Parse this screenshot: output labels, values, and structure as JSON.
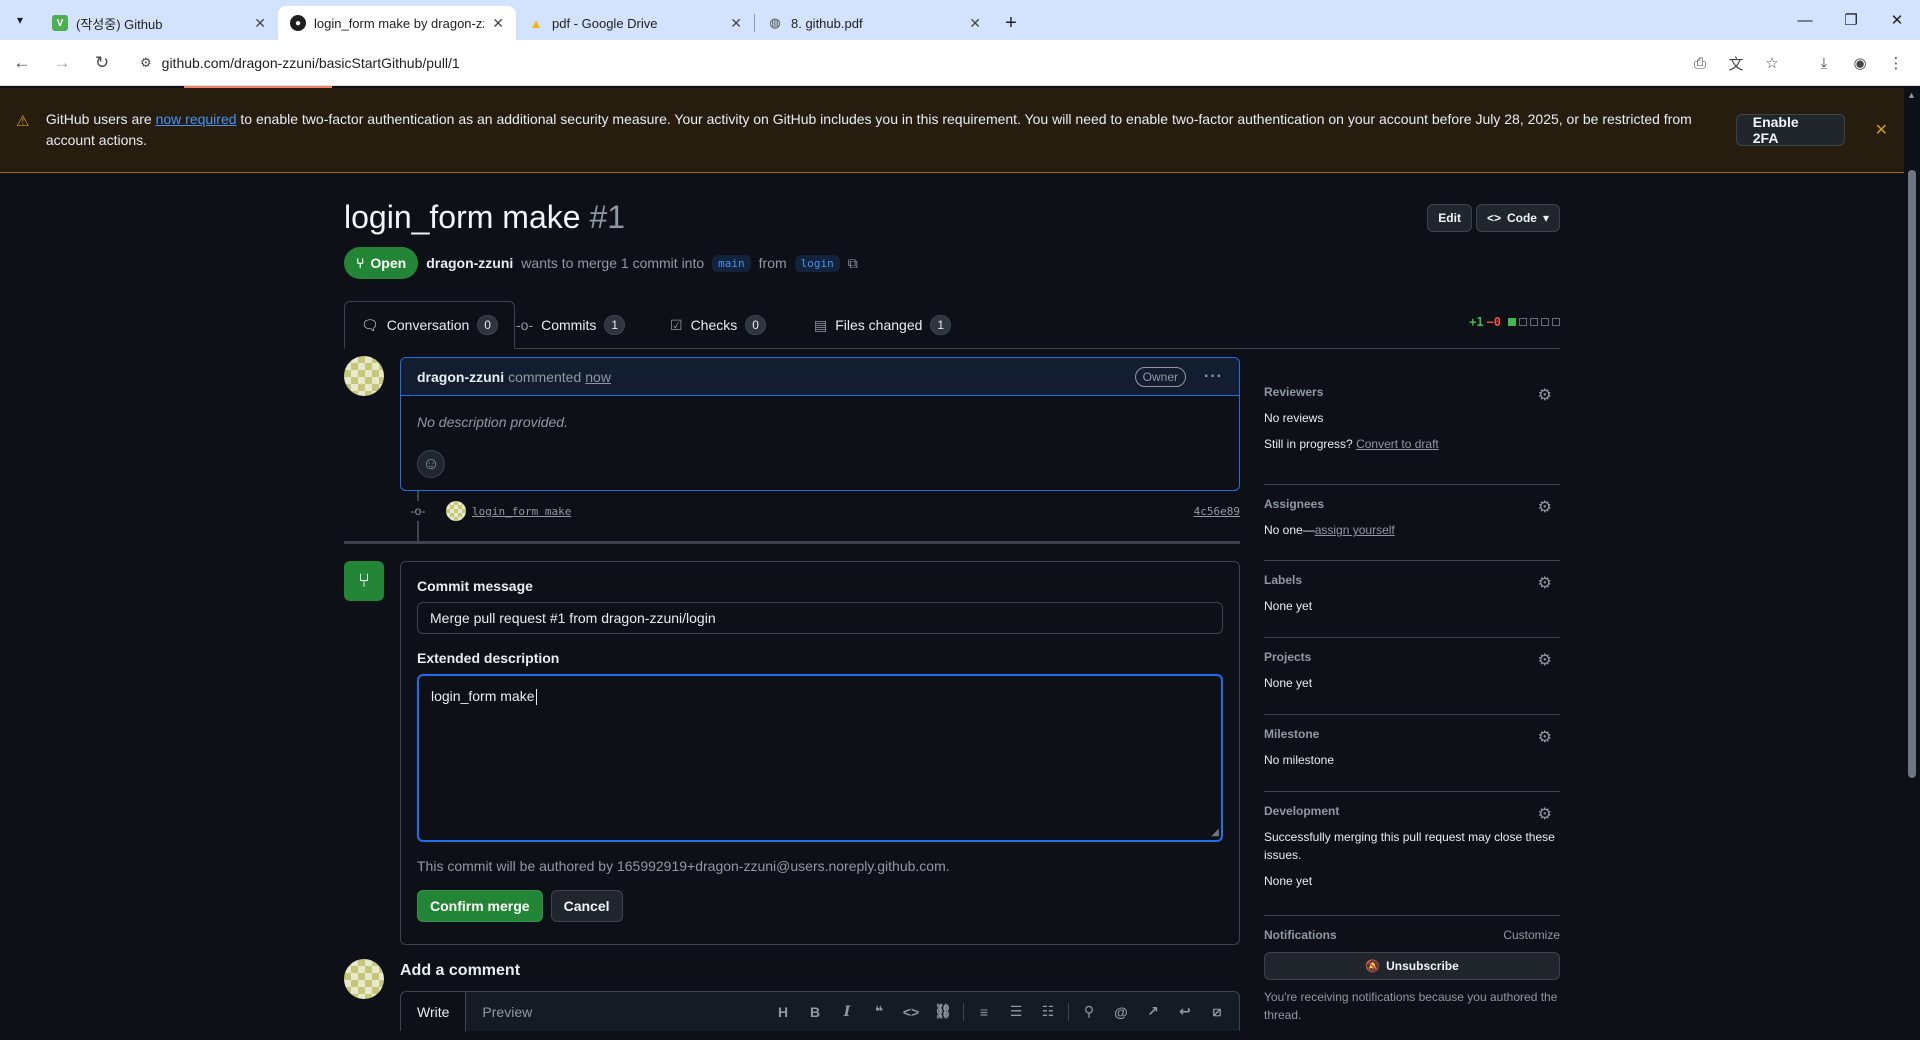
{
  "browser": {
    "tabs": [
      {
        "title": "(작성중) Github",
        "favicon": "V",
        "favicon_color": "#4caf50",
        "active": false
      },
      {
        "title": "login_form make by dragon-zzuni",
        "favicon": "github-icon",
        "active": true
      },
      {
        "title": "pdf - Google Drive",
        "favicon": "drive-icon",
        "active": false
      },
      {
        "title": "8. github.pdf",
        "favicon": "globe-icon",
        "active": false
      }
    ],
    "url": "github.com/dragon-zzuni/basicStartGithub/pull/1"
  },
  "banner": {
    "text_before": "GitHub users are ",
    "link": "now required",
    "text_after": " to enable two-factor authentication as an additional security measure. Your activity on GitHub includes you in this requirement. You will need to enable two-factor authentication on your account before July 28, 2025, or be restricted from account actions.",
    "button": "Enable 2FA"
  },
  "pr": {
    "title": "login_form make",
    "number": "#1",
    "edit_label": "Edit",
    "code_label": "Code",
    "state": "Open",
    "author": "dragon-zzuni",
    "merge_text": "wants to merge 1 commit into",
    "base_branch": "main",
    "from_text": "from",
    "head_branch": "login"
  },
  "tabs": [
    {
      "label": "Conversation",
      "count": "0"
    },
    {
      "label": "Commits",
      "count": "1"
    },
    {
      "label": "Checks",
      "count": "0"
    },
    {
      "label": "Files changed",
      "count": "1"
    }
  ],
  "diffstat": {
    "additions": "+1",
    "deletions": "−0"
  },
  "comment": {
    "author": "dragon-zzuni",
    "action": "commented",
    "time": "now",
    "badge": "Owner",
    "body": "No description provided."
  },
  "commit": {
    "message": "login_form make",
    "sha": "4c56e89"
  },
  "merge": {
    "commit_message_label": "Commit message",
    "commit_message_value": "Merge pull request #1 from dragon-zzuni/login",
    "extended_label": "Extended description",
    "extended_value": "login_form make",
    "author_note": "This commit will be authored by 165992919+dragon-zzuni@users.noreply.github.com.",
    "confirm_label": "Confirm merge",
    "cancel_label": "Cancel"
  },
  "add_comment": {
    "title": "Add a comment",
    "write_tab": "Write",
    "preview_tab": "Preview"
  },
  "sidebar": {
    "reviewers": {
      "title": "Reviewers",
      "value": "No reviews",
      "sub_text": "Still in progress?",
      "sub_link": "Convert to draft"
    },
    "assignees": {
      "title": "Assignees",
      "value": "No one—",
      "link": "assign yourself"
    },
    "labels": {
      "title": "Labels",
      "value": "None yet"
    },
    "projects": {
      "title": "Projects",
      "value": "None yet"
    },
    "milestone": {
      "title": "Milestone",
      "value": "No milestone"
    },
    "development": {
      "title": "Development",
      "desc": "Successfully merging this pull request may close these issues.",
      "value": "None yet"
    },
    "notifications": {
      "title": "Notifications",
      "customize": "Customize",
      "button": "Unsubscribe",
      "note": "You're receiving notifications because you authored the thread."
    }
  }
}
